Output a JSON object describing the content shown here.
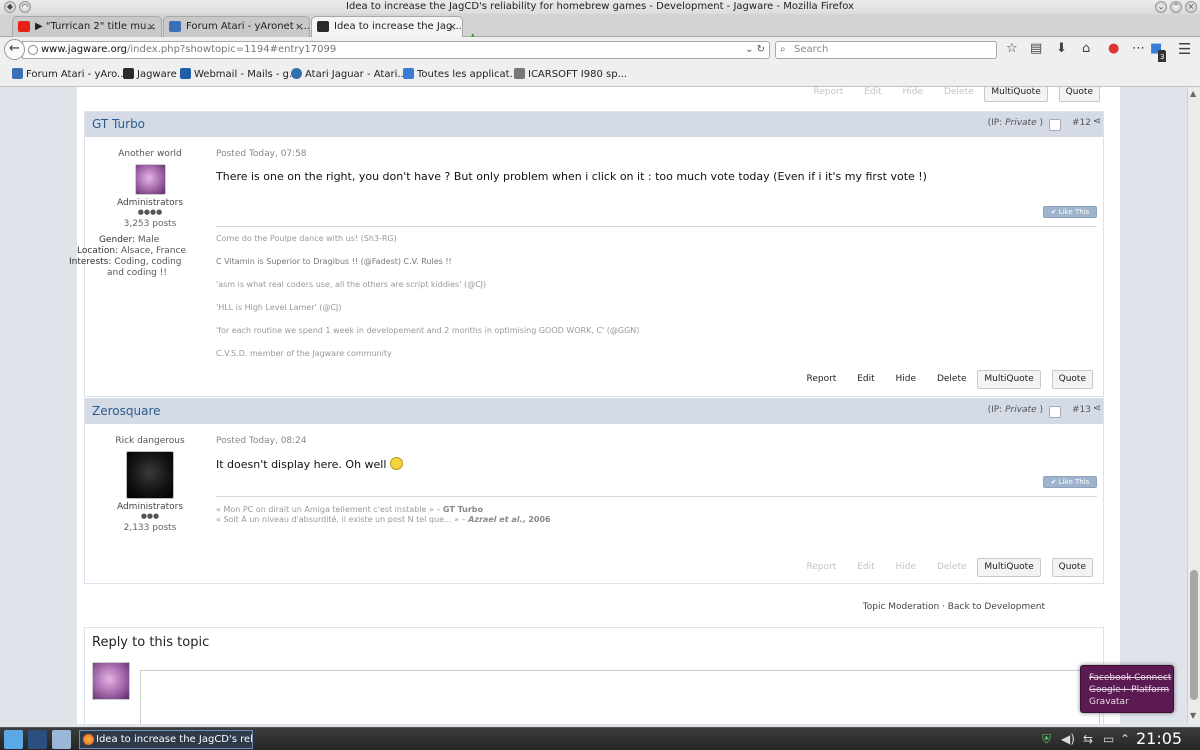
{
  "window": {
    "title": "Idea to increase the JagCD's reliability for homebrew games - Development - Jagware - Mozilla Firefox"
  },
  "tabs": [
    {
      "label": "▶ \"Turrican 2\" title mu...",
      "favicon_color": "#e62117",
      "active": false
    },
    {
      "label": "Forum Atari - yAronet -...",
      "favicon_color": "#3b6fb6",
      "active": false
    },
    {
      "label": "Idea to increase the Jag...",
      "favicon_color": "#2a2a2a",
      "active": true
    }
  ],
  "url": {
    "host": "www.jagware.org",
    "rest": "/index.php?showtopic=1194#entry17099"
  },
  "search": {
    "placeholder": "Search"
  },
  "bookmarks": [
    {
      "label": "Forum Atari - yAro...",
      "color": "#3b6fb6"
    },
    {
      "label": "Jagware",
      "color": "#2a2a2a"
    },
    {
      "label": "Webmail - Mails - g...",
      "color": "#1e5fa8"
    },
    {
      "label": "Atari Jaguar - Atari...",
      "color": "#2f6fb0"
    },
    {
      "label": "Toutes les applicat...",
      "color": "#3a7bd5"
    },
    {
      "label": "ICARSOFT I980 sp...",
      "color": "#777777"
    }
  ],
  "badge_count": "3",
  "post_actions": {
    "report": "Report",
    "edit": "Edit",
    "hide": "Hide",
    "delete": "Delete",
    "multiquote": "MultiQuote",
    "quote": "Quote"
  },
  "like_label": "✔ Like This",
  "posts": [
    {
      "author": "GT Turbo",
      "ip_label": "(IP: ",
      "ip_value": "Private",
      "ip_close": " )",
      "number": "#12",
      "user_title": "Another world",
      "group": "Administrators",
      "pips": "●●●●",
      "post_count": "3,253 posts",
      "gender_label": "Gender:",
      "gender": "Male",
      "location_label": "Location:",
      "location": "Alsace, France",
      "interests_label": "Interests:",
      "interests_1": "Coding, coding",
      "interests_2": "and coding !!",
      "posted": "Posted Today, 07:58",
      "message": "There is one on the right, you don't have ? But only problem when i click on it : too much vote today (Even if i it's my first vote !)",
      "signature": [
        "Come do the Poulpe dance with us! (Sh3-RG)",
        "C Vitamin is Superior to Dragibus !! (@Fadest) C.V. Rules !!",
        "'asm is what real coders use, all the others are script kiddies' (@CJ)",
        "'HLL is High Level Lamer' (@CJ)",
        "'for each routine we spend 1 week in developement and 2 months in optimising GOOD WORK, C' (@GGN)",
        "C.V.S.D. member of the Jagware community"
      ]
    },
    {
      "author": "Zerosquare",
      "ip_label": "(IP: ",
      "ip_value": "Private",
      "ip_close": " )",
      "number": "#13",
      "user_title": "Rick dangerous",
      "group": "Administrators",
      "pips": "●●●",
      "post_count": "2,133 posts",
      "posted": "Posted Today, 08:24",
      "message": "It doesn't display here. Oh well",
      "signature": [
        "« Mon PC on dirait un Amiga tellement c'est instable » – ",
        "GT Turbo",
        "« Soit A un niveau d'absurdité, il existe un post N tel que... » – ",
        "Azrael et al.",
        ", 2006"
      ]
    }
  ],
  "moderation": "Topic Moderation · Back to Development",
  "reply": {
    "title": "Reply to this topic"
  },
  "popup": {
    "line1": "Facebook Connect",
    "line2": "Google+ Platform",
    "line3": "Gravatar"
  },
  "taskbar": {
    "item": "Idea to increase the JagCD's reliabi",
    "clock": "21:05"
  }
}
